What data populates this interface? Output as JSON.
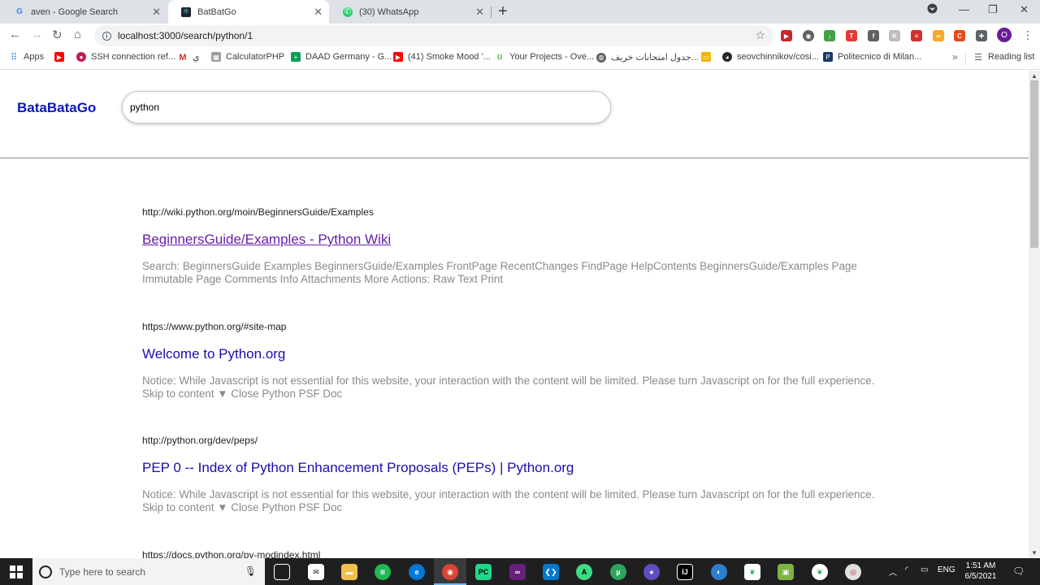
{
  "tabs": [
    {
      "title": "aven - Google Search",
      "icon": "google-icon",
      "active": false
    },
    {
      "title": "BatBatGo",
      "icon": "react-icon",
      "active": true
    },
    {
      "title": "(30) WhatsApp",
      "icon": "whatsapp-icon",
      "active": false
    }
  ],
  "toolbar": {
    "url": "localhost:3000/search/python/1"
  },
  "bookmarks": [
    {
      "label": "Apps"
    },
    {
      "label": ""
    },
    {
      "label": "SSH connection ref..."
    },
    {
      "label": "ي"
    },
    {
      "label": "CalculatorPHP"
    },
    {
      "label": "DAAD Germany - G..."
    },
    {
      "label": "(41) Smoke Mood '..."
    },
    {
      "label": "Your Projects - Ove..."
    },
    {
      "label": "جدول امتحانات خريف..."
    },
    {
      "label": ""
    },
    {
      "label": "seovchinnikov/cosi..."
    },
    {
      "label": "Politecnico di Milan..."
    },
    {
      "label": "Reading list"
    }
  ],
  "page": {
    "logo": "BataBataGo",
    "search_value": "python",
    "results": [
      {
        "url": "http://wiki.python.org/moin/BeginnersGuide/Examples",
        "title": "BeginnersGuide/Examples - Python Wiki",
        "visited": true,
        "snippet": "Search: BeginnersGuide Examples BeginnersGuide/Examples FrontPage RecentChanges FindPage HelpContents BeginnersGuide/Examples Page Immutable Page Comments Info Attachments More Actions: Raw Text Print"
      },
      {
        "url": "https://www.python.org/#site-map",
        "title": "Welcome to Python.org",
        "visited": false,
        "snippet": "Notice: While Javascript is not essential for this website, your interaction with the content will be limited. Please turn Javascript on for the full experience. Skip to content ▼ Close Python PSF Doc"
      },
      {
        "url": "http://python.org/dev/peps/",
        "title": "PEP 0 -- Index of Python Enhancement Proposals (PEPs) | Python.org",
        "visited": false,
        "snippet": "Notice: While Javascript is not essential for this website, your interaction with the content will be limited. Please turn Javascript on for the full experience. Skip to content ▼ Close Python PSF Doc"
      },
      {
        "url": "https://docs.python.org/py-modindex.html",
        "title": "",
        "visited": false,
        "snippet": ""
      }
    ]
  },
  "taskbar": {
    "search_placeholder": "Type here to search",
    "language": "ENG",
    "time": "1:51 AM",
    "date": "6/5/2021"
  },
  "colors": {
    "logo": "#0a16b8",
    "link": "#1a0dab",
    "visited_link": "#681da8",
    "snippet": "#8a8a8a"
  }
}
